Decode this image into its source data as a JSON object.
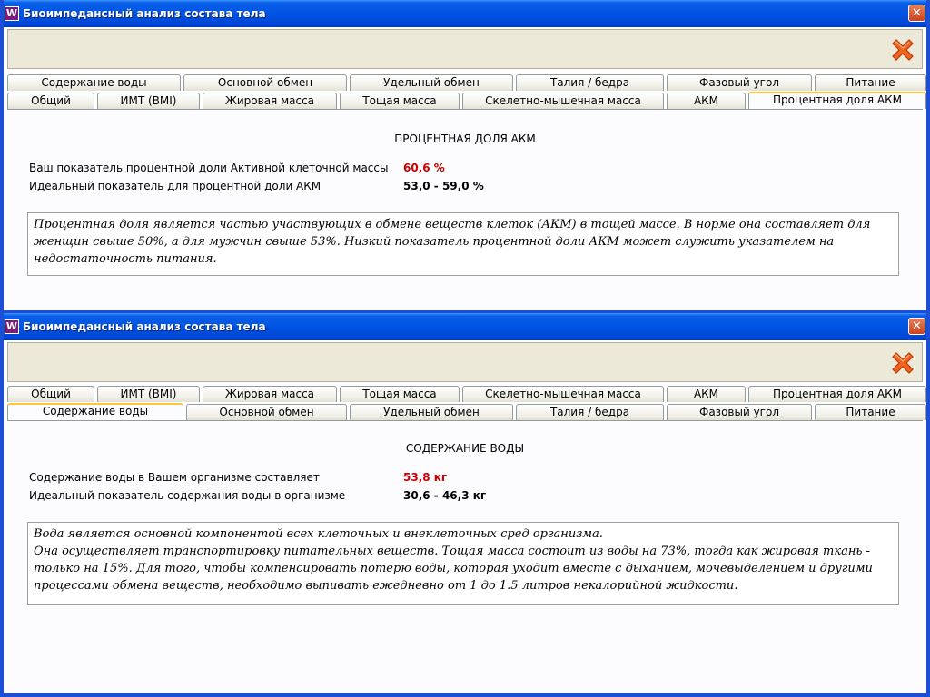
{
  "window_title": "Биоимпедансный анализ состава тела",
  "app_icon_letter": "W",
  "close_glyph": "✕",
  "tabs_row_a": [
    "Содержание воды",
    "Основной обмен",
    "Удельный обмен",
    "Талия / бедра",
    "Фазовый угол",
    "Питание"
  ],
  "tabs_row_b": [
    "Общий",
    "ИМТ (BMI)",
    "Жировая масса",
    "Тощая масса",
    "Скелетно-мышечная масса",
    "АКМ",
    "Процентная доля АКМ"
  ],
  "window1": {
    "active_tab": "Процентная доля АКМ",
    "heading": "ПРОЦЕНТНАЯ ДОЛЯ  АКМ",
    "row1_label": "Ваш показатель процентной доли Активной клеточной массы",
    "row1_value": "60,6  %",
    "row2_label": "Идеальный показатель для процентной доли АКМ",
    "row2_value": "53,0 - 59,0  %",
    "description": "Процентная доля является частью участвующих в обмене веществ клеток (АКМ) в тощей массе. В норме она составляет для женщин свыше 50%, а для мужчин свыше 53%. Низкий показатель процентной доли АКМ может служить указателем на недостаточность питания."
  },
  "window2": {
    "active_tab": "Содержание воды",
    "heading": "СОДЕРЖАНИЕ ВОДЫ",
    "row1_label": "Содержание воды в Вашем организме составляет",
    "row1_value": "53,8  кг",
    "row2_label": "Идеальный показатель содержания воды в организме",
    "row2_value": "30,6 - 46,3  кг",
    "description_line1": "Вода является основной компонентой всех клеточных и внеклеточных сред организма.",
    "description_rest": "Она осуществляет транспортировку питательных веществ. Тощая масса состоит из воды на 73%, тогда как жировая ткань - только на 15%. Для того, чтобы компенсировать потерю воды, которая уходит вместе с дыханием, мочевыделением и другими процессами обмена веществ, необходимо выпивать ежедневно от 1 до 1.5 литров некалорийной жидкости."
  },
  "colors": {
    "title_blue": "#0054e3",
    "value_red": "#cc0000",
    "tab_highlight": "#ffc83c"
  },
  "icons": {
    "toolbar_close": "red-x-icon",
    "title_close": "close-icon",
    "app": "app-logo-icon"
  }
}
